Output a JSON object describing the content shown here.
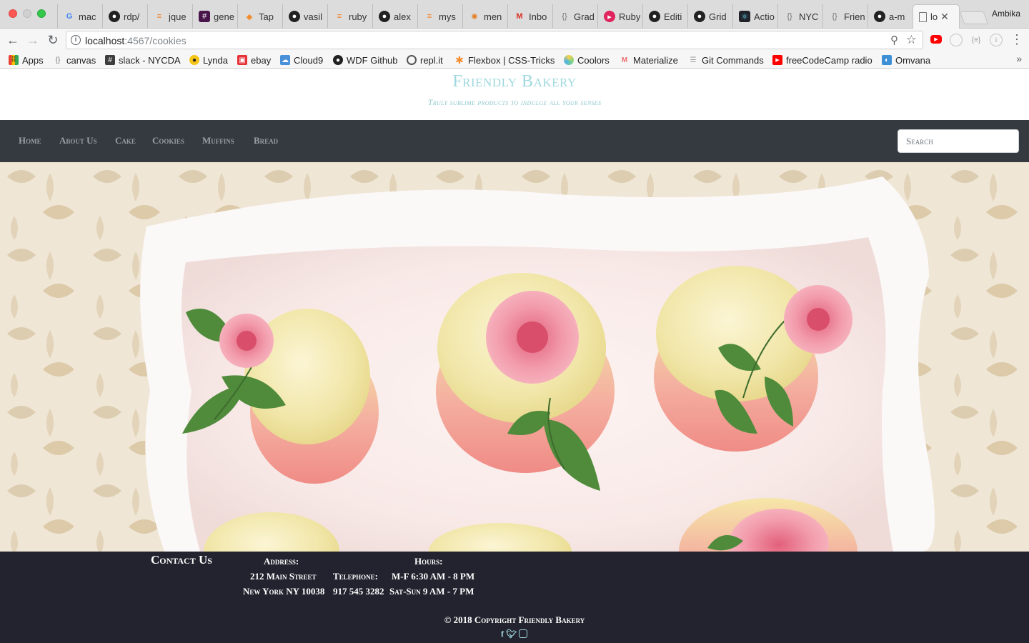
{
  "browser": {
    "tabs": [
      {
        "label": "mac",
        "icon": "google-icon"
      },
      {
        "label": "rdp/",
        "icon": "github-icon"
      },
      {
        "label": "jque",
        "icon": "stackoverflow-icon"
      },
      {
        "label": "gene",
        "icon": "slack-icon"
      },
      {
        "label": "Tap",
        "icon": "tap-icon"
      },
      {
        "label": "vasil",
        "icon": "github-icon"
      },
      {
        "label": "ruby",
        "icon": "stackoverflow-icon"
      },
      {
        "label": "alex",
        "icon": "github-icon"
      },
      {
        "label": "mys",
        "icon": "stackoverflow-icon"
      },
      {
        "label": "men",
        "icon": "gear-icon"
      },
      {
        "label": "Inbo",
        "icon": "gmail-icon"
      },
      {
        "label": "Grad",
        "icon": "braces-icon"
      },
      {
        "label": "Ruby",
        "icon": "ruby-icon"
      },
      {
        "label": "Editi",
        "icon": "github-icon"
      },
      {
        "label": "Grid",
        "icon": "github-icon"
      },
      {
        "label": "Actio",
        "icon": "react-icon"
      },
      {
        "label": "NYC",
        "icon": "braces-icon"
      },
      {
        "label": "Frien",
        "icon": "braces-icon"
      },
      {
        "label": "a-m",
        "icon": "github-icon"
      }
    ],
    "active_tab": {
      "label": "lo",
      "icon": "page-icon"
    },
    "profile_name": "Ambika",
    "url_host": "localhost",
    "url_path": ":4567/cookies",
    "bookmarks": [
      {
        "label": "Apps",
        "icon": "apps-grid-icon"
      },
      {
        "label": "canvas",
        "icon": "braces-icon"
      },
      {
        "label": "slack - NYCDA",
        "icon": "slack-icon"
      },
      {
        "label": "Lynda",
        "icon": "lynda-icon"
      },
      {
        "label": "ebay",
        "icon": "ebay-icon"
      },
      {
        "label": "Cloud9",
        "icon": "cloud9-icon"
      },
      {
        "label": "WDF Github",
        "icon": "github-icon"
      },
      {
        "label": "repl.it",
        "icon": "replit-icon"
      },
      {
        "label": "Flexbox | CSS-Tricks",
        "icon": "star-icon"
      },
      {
        "label": "Coolors",
        "icon": "coolors-icon"
      },
      {
        "label": "Materialize",
        "icon": "materialize-icon"
      },
      {
        "label": "Git Commands",
        "icon": "page-icon"
      },
      {
        "label": "freeCodeCamp radio",
        "icon": "youtube-icon"
      },
      {
        "label": "Omvana",
        "icon": "omvana-icon"
      }
    ]
  },
  "site": {
    "title": "Friendly Bakery",
    "tagline": "Truly sublime products to indulge all your senses",
    "nav": [
      "Home",
      "About Us",
      "Cake",
      "Cookies",
      "Muffins",
      "Bread"
    ],
    "search_placeholder": "Search",
    "colors": {
      "title": "#9fd8de",
      "nav_bg": "#343a40",
      "footer_bg": "#22232e"
    }
  },
  "footer": {
    "contact_heading": "Contact Us",
    "address_label": "Address:",
    "address_line1": "212 Main Street",
    "address_line2": "New York NY 10038",
    "telephone_label": "Telephone:",
    "telephone": "917 545 3282",
    "hours_label": "Hours:",
    "hours_weekday": "M-F 6:30 AM - 8 PM",
    "hours_weekend": "Sat-Sun 9 AM - 7 PM",
    "copyright": "© 2018 Copyright Friendly Bakery",
    "social_icons": [
      "facebook-icon",
      "twitter-icon",
      "instagram-icon"
    ]
  }
}
